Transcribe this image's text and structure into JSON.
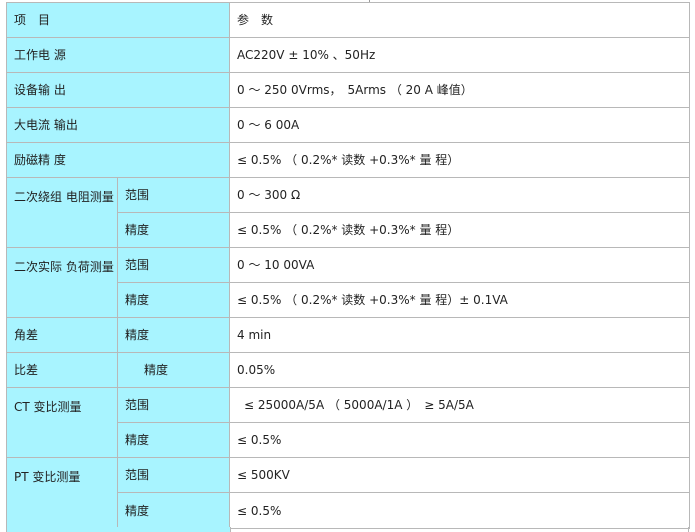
{
  "header": {
    "item_label": "项　目",
    "param_label": "参　数"
  },
  "rows": {
    "power": {
      "label": "工作电 源",
      "value": "AC220V ± 10% 、50Hz"
    },
    "output": {
      "label": "设备输 出",
      "value": "0 ～ 250 0Vrms，　5Arms （ 20 A 峰值）"
    },
    "high_current": {
      "label": "大电流 输出",
      "value": "0 ～ 6 00A"
    },
    "excitation": {
      "label": "励磁精 度",
      "value": "≤ 0.5% （ 0.2%* 读数 +0.3%* 量 程）"
    },
    "winding_resistance": {
      "label": "二次绕组 电阻测量",
      "range_label": "范围",
      "range_value": "0 ～ 300 Ω",
      "accuracy_label": "精度",
      "accuracy_value": "≤ 0.5% （ 0.2%* 读数 +0.3%* 量 程）"
    },
    "actual_load": {
      "label": "二次实际 负荷测量",
      "range_label": "范围",
      "range_value": "0 ～ 10 00VA",
      "accuracy_label": "精度",
      "accuracy_value": "≤ 0.5% （ 0.2%* 读数 +0.3%* 量 程）± 0.1VA"
    },
    "angle_error": {
      "label": "角差",
      "accuracy_label": "精度",
      "accuracy_value": "4 min"
    },
    "ratio_error": {
      "label": "比差",
      "accuracy_label": "精度",
      "accuracy_value": "0.05%"
    },
    "ct_ratio": {
      "label": "CT 变比测量",
      "range_label": "范围",
      "range_value": "≤ 25000A/5A （ 5000A/1A ）　≥ 5A/5A",
      "accuracy_label": "精度",
      "accuracy_value": "≤ 0.5%"
    },
    "pt_ratio": {
      "label": "PT 变比测量",
      "range_label": "范围",
      "range_value": "≤ 500KV",
      "accuracy_label": "精度",
      "accuracy_value": "≤ 0.5%"
    }
  },
  "colors": {
    "label_background": "#a8f4ff",
    "value_background": "#ffffff",
    "border": "#b8b8b8",
    "text": "#222222"
  }
}
